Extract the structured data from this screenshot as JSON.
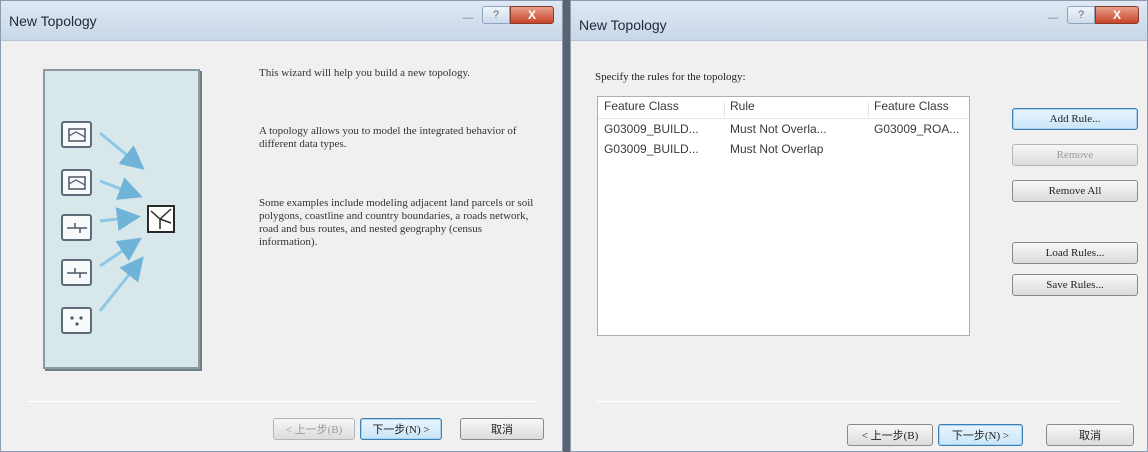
{
  "dialog1": {
    "title": "New Topology",
    "buttons": {
      "minimize": "—",
      "help": "?",
      "close": "X"
    },
    "illustration": {
      "layer_icons": [
        "polygon-layer-icon",
        "polygon-layer-icon",
        "line-layer-icon",
        "line-layer-icon",
        "point-layer-icon"
      ],
      "topology_icon": "topology-icon"
    },
    "description": {
      "p1": "This wizard will help you build a new topology.",
      "p2": "A topology allows you to model the integrated behavior of different data types.",
      "p3": "Some examples include modeling adjacent land parcels or soil polygons, coastline and country boundaries, a roads network, road and bus routes, and nested geography (census information)."
    },
    "footer": {
      "back": "< 上一步(B)",
      "next": "下一步(N) >",
      "cancel": "取消"
    }
  },
  "dialog2": {
    "title": "New Topology",
    "buttons": {
      "minimize": "—",
      "help": "?",
      "close": "X"
    },
    "prompt": "Specify the rules for the topology:",
    "rules": {
      "columns": [
        "Feature Class",
        "Rule",
        "Feature Class"
      ],
      "rows": [
        [
          "G03009_BUILD...",
          "Must Not Overla...",
          "G03009_ROA..."
        ],
        [
          "G03009_BUILD...",
          "Must Not Overlap",
          ""
        ]
      ]
    },
    "side_buttons": {
      "add": "Add Rule...",
      "remove": "Remove",
      "remove_all": "Remove All",
      "load": "Load Rules...",
      "save": "Save Rules..."
    },
    "footer": {
      "back": "< 上一步(B)",
      "next": "下一步(N) >",
      "cancel": "取消"
    }
  }
}
